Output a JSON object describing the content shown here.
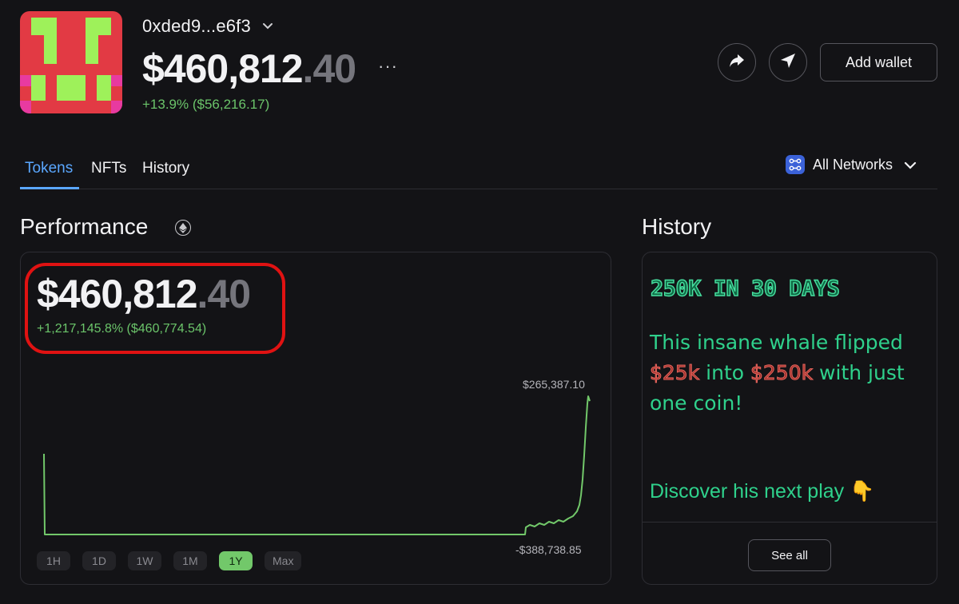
{
  "wallet": {
    "name": "0xded9...e6f3",
    "balance_main": "$460,812",
    "balance_decimal": ".40",
    "more": "···",
    "change": "+13.9% ($56,216.17)",
    "add_wallet_label": "Add wallet"
  },
  "tabs": [
    {
      "label": "Tokens",
      "active": true
    },
    {
      "label": "NFTs",
      "active": false
    },
    {
      "label": "History",
      "active": false
    }
  ],
  "network_selector": {
    "label": "All Networks"
  },
  "performance": {
    "title": "Performance",
    "value_main": "$460,812",
    "value_decimal": ".40",
    "change": "+1,217,145.8% ($460,774.54)",
    "axis_max_label": "$265,387.10",
    "axis_min_label": "-$388,738.85",
    "ranges": [
      {
        "label": "1H",
        "active": false
      },
      {
        "label": "1D",
        "active": false
      },
      {
        "label": "1W",
        "active": false
      },
      {
        "label": "1M",
        "active": false
      },
      {
        "label": "1Y",
        "active": true
      },
      {
        "label": "Max",
        "active": false
      }
    ],
    "line_color": "#72c86a"
  },
  "history": {
    "title": "History",
    "promo_heading": "250K IN 30 DAYS",
    "promo_line_pre": "This insane whale flipped ",
    "promo_amount_1": "$25k",
    "promo_mid": " into ",
    "promo_amount_2": "$250k",
    "promo_line_post": " with just one coin!",
    "promo_cta": "Discover his next play 👇",
    "see_all_label": "See all"
  },
  "colors": {
    "accent": "#5aa7ff",
    "positive": "#6bc46a",
    "highlight": "#e01212",
    "promo": "#2fd18c"
  }
}
